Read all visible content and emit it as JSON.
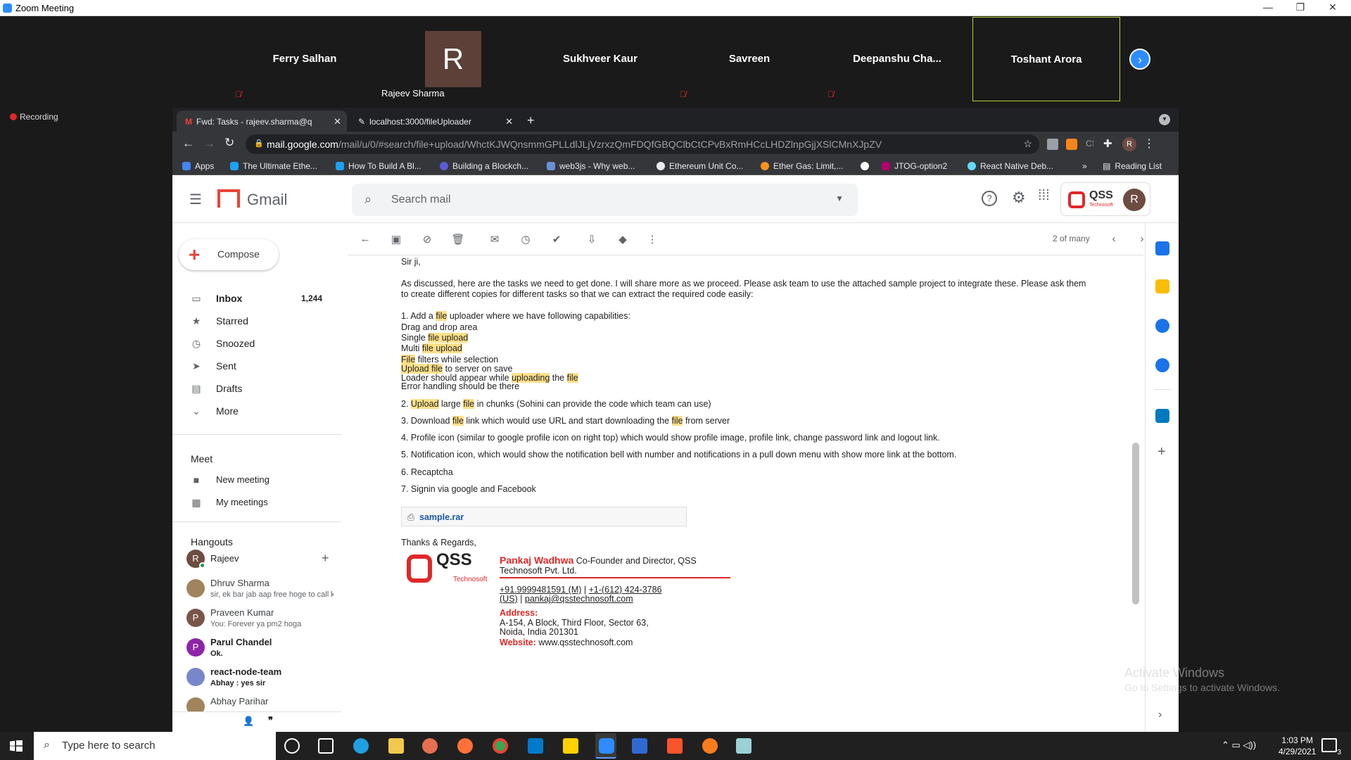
{
  "window": {
    "title": "Zoom Meeting",
    "recording_label": "Recording"
  },
  "participants": [
    {
      "name": "Ferry Salhan",
      "muted": true
    },
    {
      "name": "Rajeev Sharma",
      "initial": "R",
      "muted": false
    },
    {
      "name": "Sukhveer Kaur",
      "muted": false
    },
    {
      "name": "Savreen",
      "muted": true
    },
    {
      "name": "Deepanshu  Cha...",
      "muted": true
    },
    {
      "name": "Toshant Arora",
      "muted": false,
      "active_speaker": true
    }
  ],
  "browser": {
    "tabs": [
      {
        "label": "Fwd: Tasks - rajeev.sharma@q",
        "active": true
      },
      {
        "label": "localhost:3000/fileUploader",
        "active": false
      }
    ],
    "new_tab": "+",
    "url_host": "mail.google.com",
    "url_rest": "/mail/u/0/#search/file+upload/WhctKJWQnsmmGPLLdlJLjVzrxzQmFDQfGBQClbCtCPvBxRmHCcLHDZlnpGjjXSlCMnXJpZV",
    "profile_initial": "R",
    "bookmarks": [
      {
        "label": "Apps",
        "color": "#4285f4"
      },
      {
        "label": "The Ultimate Ethe...",
        "color": "#1da1f2"
      },
      {
        "label": "How To Build A Bl...",
        "color": "#1da1f2"
      },
      {
        "label": "Building a Blockch...",
        "color": "#5b5bd6"
      },
      {
        "label": "web3js - Why web...",
        "color": "#6b8fd6"
      },
      {
        "label": "Ethereum Unit Co...",
        "color": "#e8eaed"
      },
      {
        "label": "Ether Gas: Limit,...",
        "color": "#f7931a"
      },
      {
        "label": "",
        "color": "#ea4335"
      },
      {
        "label": "JTOG-option2",
        "color": "#b0006d"
      },
      {
        "label": "React Native Deb...",
        "color": "#61dafb"
      }
    ],
    "bookmarks_more": "»",
    "reading_list": "Reading List"
  },
  "gmail": {
    "product": "Gmail",
    "search_placeholder": "Search mail",
    "account_initial": "R",
    "brand": "QSS",
    "brand_sub": "Technosoft",
    "compose": "Compose",
    "nav": [
      {
        "label": "Inbox",
        "count": "1,244",
        "icon": "inbox-icon",
        "glyph": "▭"
      },
      {
        "label": "Starred",
        "count": "",
        "icon": "star-icon",
        "glyph": "★"
      },
      {
        "label": "Snoozed",
        "count": "",
        "icon": "clock-icon",
        "glyph": "◷"
      },
      {
        "label": "Sent",
        "count": "",
        "icon": "send-icon",
        "glyph": "➤"
      },
      {
        "label": "Drafts",
        "count": "",
        "icon": "draft-icon",
        "glyph": "▤"
      },
      {
        "label": "More",
        "count": "",
        "icon": "chevron-down-icon",
        "glyph": "⌄"
      }
    ],
    "meet": {
      "title": "Meet",
      "new_meeting": "New meeting",
      "my_meetings": "My meetings"
    },
    "hangouts": {
      "title": "Hangouts",
      "self": "Rajeev",
      "contacts": [
        {
          "name": "Dhruv Sharma",
          "status": "sir, ek bar jab aap free hoge to call k",
          "initial": "",
          "color": "#a0845c",
          "bold": false
        },
        {
          "name": "Praveen Kumar",
          "status": "You: Forever ya pm2 hoga",
          "initial": "P",
          "color": "#795548",
          "bold": false
        },
        {
          "name": "Parul Chandel",
          "status": "Ok.",
          "initial": "P",
          "color": "#8e24aa",
          "bold": true
        },
        {
          "name": "react-node-team",
          "status": "Abhay : yes sir",
          "initial": "",
          "color": "#7986cb",
          "bold": true
        },
        {
          "name": "Abhay Parihar",
          "status": "",
          "initial": "",
          "color": "#a0845c",
          "bold": false
        }
      ]
    },
    "pager": "2 of many"
  },
  "email": {
    "greeting": "Sir ji,",
    "intro1": "As discussed, here are the tasks we need to get done. I will share more as we proceed. Please ask team to use the attached sample project to integrate these. Please ask them",
    "intro2": "to create different copies for different tasks so that we can extract the required code easily:",
    "item1": {
      "a": "1. Add a ",
      "b": "file",
      "c": " uploader where we have following capabilities:"
    },
    "sub1": "Drag and drop area",
    "sub2": {
      "a": "Single ",
      "b": "file",
      "c": " ",
      "d": "upload"
    },
    "sub3": {
      "a": "Multi ",
      "b": "file",
      "c": " ",
      "d": "upload"
    },
    "sub4": {
      "a": "File",
      "b": " filters while selection"
    },
    "sub5": {
      "a": "Upload",
      "b": " ",
      "c": "file",
      "d": " to server on save"
    },
    "sub6": {
      "a": "Loader should appear while ",
      "b": "uploading",
      "c": " the ",
      "d": "file"
    },
    "sub7": "Error handling should be there",
    "item2": {
      "a": "2. ",
      "b": "Upload",
      "c": " large ",
      "d": "file",
      "e": " in chunks (Sohini can provide the code which team can use)"
    },
    "item3": {
      "a": "3. Download ",
      "b": "file",
      "c": " link which would use URL and start downloading the ",
      "d": "file",
      "e": " from server"
    },
    "item4": "4. Profile icon (similar to google profile icon on right top) which would show profile image, profile link, change password link and logout link.",
    "item5": "5. Notification icon, which would show the notification bell with number and notifications in a pull down menu with show more link at the bottom.",
    "item6": "6. Recaptcha",
    "item7": "7. Signin via google and Facebook",
    "attachment": "sample.rar",
    "closing": "Thanks & Regards,",
    "sig_name": "Pankaj Wadhwa",
    "sig_title": " Co-Founder and Director, QSS",
    "sig_title2": "Technosoft Pvt. Ltd.",
    "sig_phone": "+91.9999481591 (M)",
    "sig_phone_sep": " | ",
    "sig_phone2": "+1-(612) 424-3786",
    "sig_us": "(US)",
    "sig_email_sep": " | ",
    "sig_email": "pankaj@qsstechnosoft.com",
    "sig_addr_label": "Address:",
    "sig_addr1": "A-154, A Block, Third Floor, Sector 63,",
    "sig_addr2": "Noida, India 201301",
    "sig_web_label": "Website:",
    "sig_web": " www.qsstechnosoft.com",
    "logo": "QSS",
    "logo_sub": "Technosoft"
  },
  "watermark": {
    "line1": "Activate Windows",
    "line2": "Go to Settings to activate Windows."
  },
  "taskbar": {
    "search_placeholder": "Type here to search",
    "time": "1:03 PM",
    "date": "4/29/2021",
    "notifications": "3"
  },
  "colors": {
    "accent_blue": "#1a73e8",
    "highlight": "#ffe08a",
    "brand_red": "#e02828"
  }
}
